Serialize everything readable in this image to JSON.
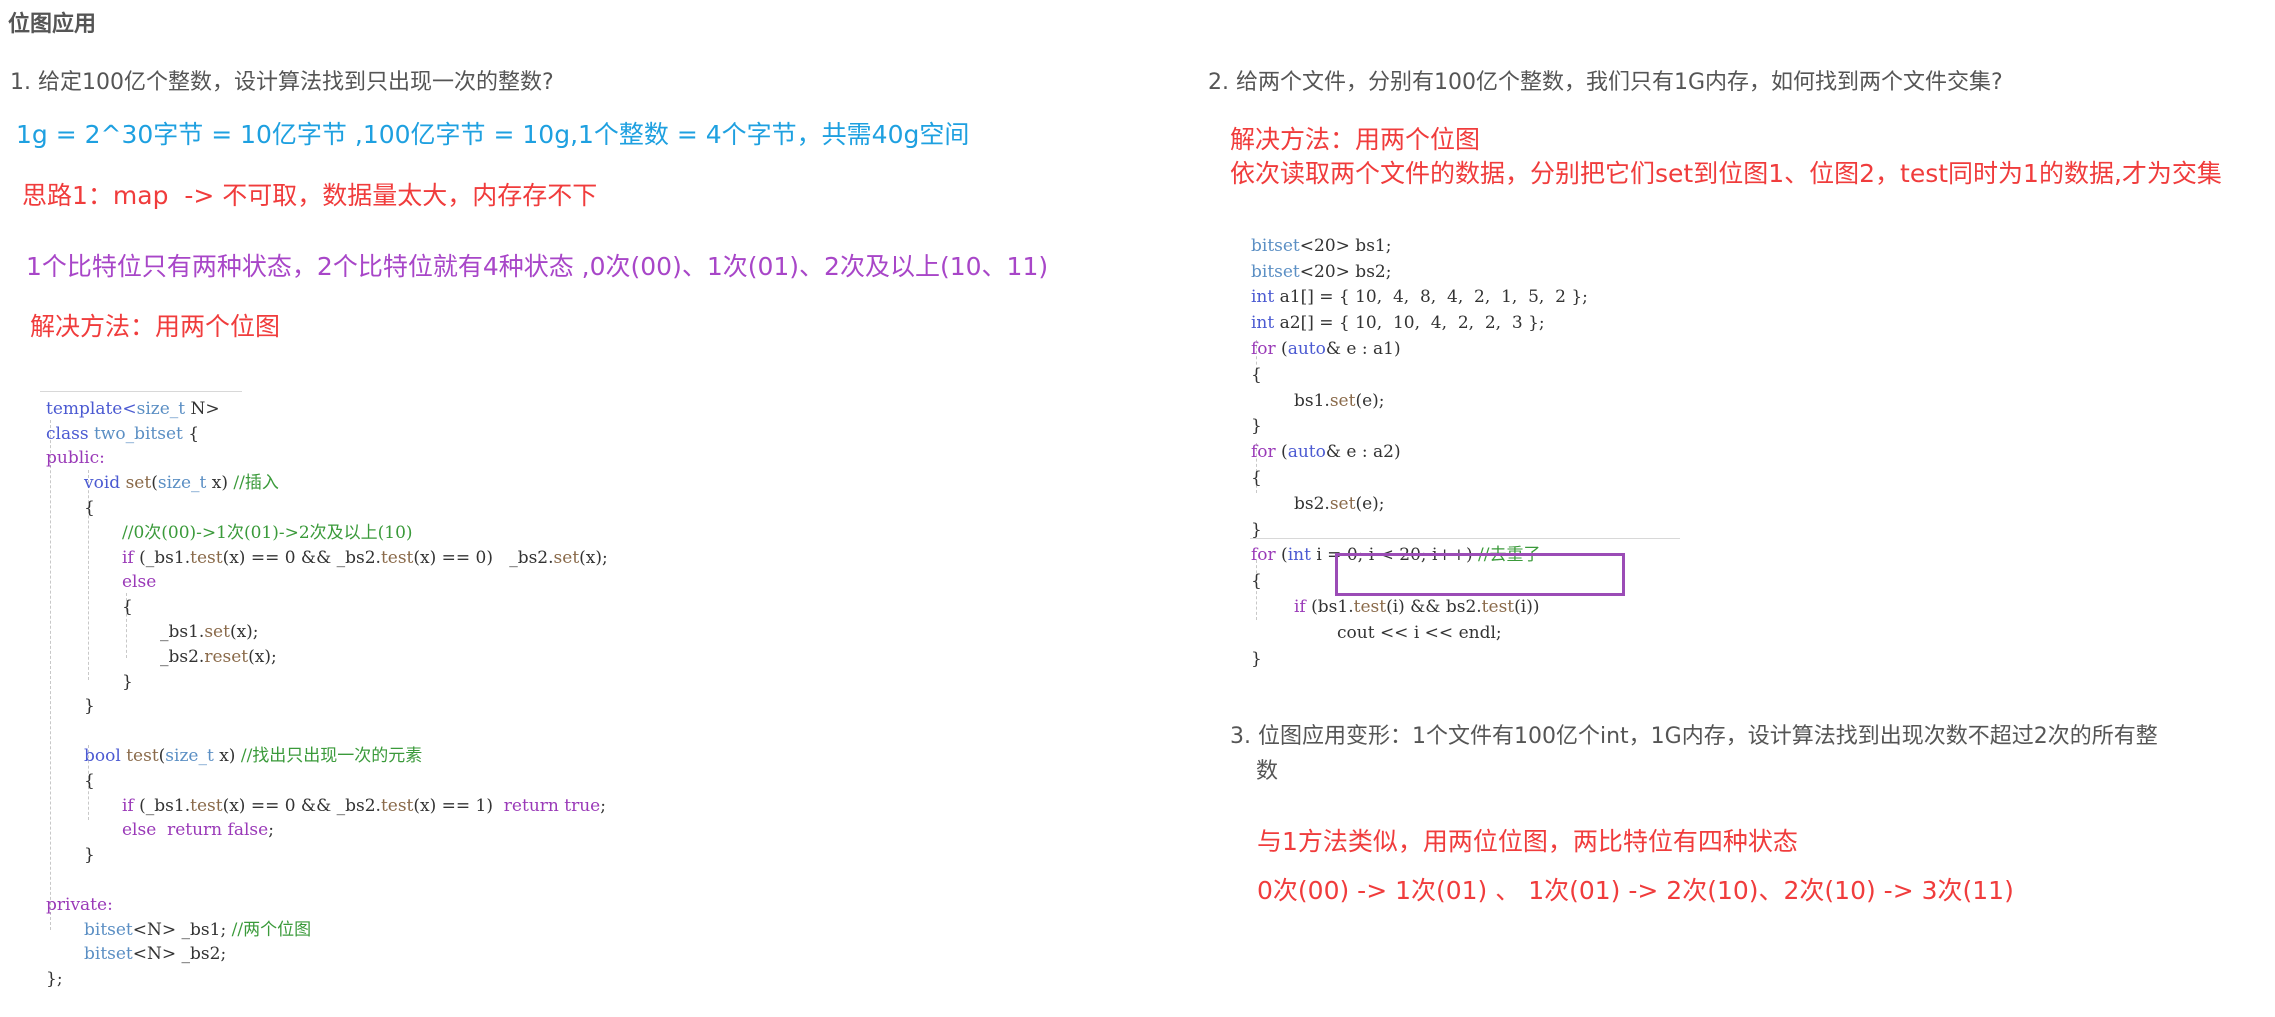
{
  "page": {
    "title": "位图应用"
  },
  "left": {
    "question": "1. 给定100亿个整数，设计算法找到只出现一次的整数?",
    "note_size": "1g = 2^30字节 = 10亿字节 ,100亿字节 = 10g,1个整数 = 4个字节，共需40g空间",
    "idea1": "思路1：map  -> 不可取，数据量太大，内存存不下",
    "bits_note": "1个比特位只有两种状态，2个比特位就有4种状态 ,0次(00)、1次(01)、2次及以上(10、11)",
    "solution": "解决方法：用两个位图",
    "code": {
      "l01": "template",
      "l01b": "size_t",
      "l01c": " N>",
      "l02a": "class",
      "l02b": "two_bitset",
      "l02c": " {",
      "l03": "public:",
      "l04a": "void",
      "l04b": "set",
      "l04c": "size_t",
      "l04d": " x) ",
      "l04e": "//插入",
      "l05": "{",
      "l06": "//0次(00)->1次(01)->2次及以上(10)",
      "l07a": "if",
      "l07b": " (_bs1.",
      "l07c": "test",
      "l07d": "(x) == 0 && _bs2.",
      "l07e": "test",
      "l07f": "(x) == 0)   _bs2.",
      "l07g": "set",
      "l07h": "(x);",
      "l08": "else",
      "l09": "{",
      "l10a": "_bs1.",
      "l10b": "set",
      "l10c": "(x);",
      "l11a": "_bs2.",
      "l11b": "reset",
      "l11c": "(x);",
      "l12": "}",
      "l13": "}",
      "l15a": "bool",
      "l15b": "test",
      "l15c": "size_t",
      "l15d": " x) ",
      "l15e": "//找出只出现一次的元素",
      "l16": "{",
      "l17a": "if",
      "l17b": " (_bs1.",
      "l17c": "test",
      "l17d": "(x) == 0 && _bs2.",
      "l17e": "test",
      "l17f": "(x) == 1)  ",
      "l17g": "return true",
      "l17h": ";",
      "l18a": "else  return false",
      "l18b": ";",
      "l19": "}",
      "l21": "private:",
      "l22a": "bitset",
      "l22b": "<N> _bs1; ",
      "l22c": "//两个位图",
      "l23a": "bitset",
      "l23b": "<N> _bs2;",
      "l24": "};"
    }
  },
  "right": {
    "question2": "2. 给两个文件，分别有100亿个整数，我们只有1G内存，如何找到两个文件交集?",
    "solution2_line1": "解决方法：用两个位图",
    "solution2_line2": "依次读取两个文件的数据，分别把它们set到位图1、位图2，test同时为1的数据,才为交集",
    "code": {
      "r01a": "bitset",
      "r01b": "<20> bs1;",
      "r02a": "bitset",
      "r02b": "<20> bs2;",
      "r03a": "int",
      "r03b": " a1[] = { 10,  4,  8,  4,  2,  1,  5,  2 };",
      "r04a": "int",
      "r04b": " a2[] = { 10,  10,  4,  2,  2,  3 };",
      "r05a": "for",
      "r05b": " (",
      "r05c": "auto",
      "r05d": "& e : a1)",
      "r06": "{",
      "r07a": "bs1.",
      "r07b": "set",
      "r07c": "(e);",
      "r08": "}",
      "r09a": "for",
      "r09b": " (",
      "r09c": "auto",
      "r09d": "& e : a2)",
      "r10": "{",
      "r11a": "bs2.",
      "r11b": "set",
      "r11c": "(e);",
      "r12": "}",
      "r13a": "for",
      "r13b": " (",
      "r13c": "int",
      "r13d": " i = 0; i < 20; i++) ",
      "r13e": "//去重了",
      "r14": "{",
      "r15a": "if",
      "r15b": " (bs1.",
      "r15c": "test",
      "r15d": "(i) && bs2.",
      "r15e": "test",
      "r15f": "(i))",
      "r16": "cout << i << endl;",
      "r17": "}"
    },
    "question3_line1": "3. 位图应用变形：1个文件有100亿个int，1G内存，设计算法找到出现次数不超过2次的所有整",
    "question3_line2": "数",
    "answer3_line1": "与1方法类似，用两位位图，两比特位有四种状态",
    "answer3_line2": "0次(00) -> 1次(01) 、 1次(01) -> 2次(10)、2次(10) -> 3次(11)"
  },
  "colors": {
    "blue": "#1ea0e0",
    "red": "#f03c3c",
    "purple": "#a846c8",
    "highlight_box": "#9b4cb6"
  }
}
